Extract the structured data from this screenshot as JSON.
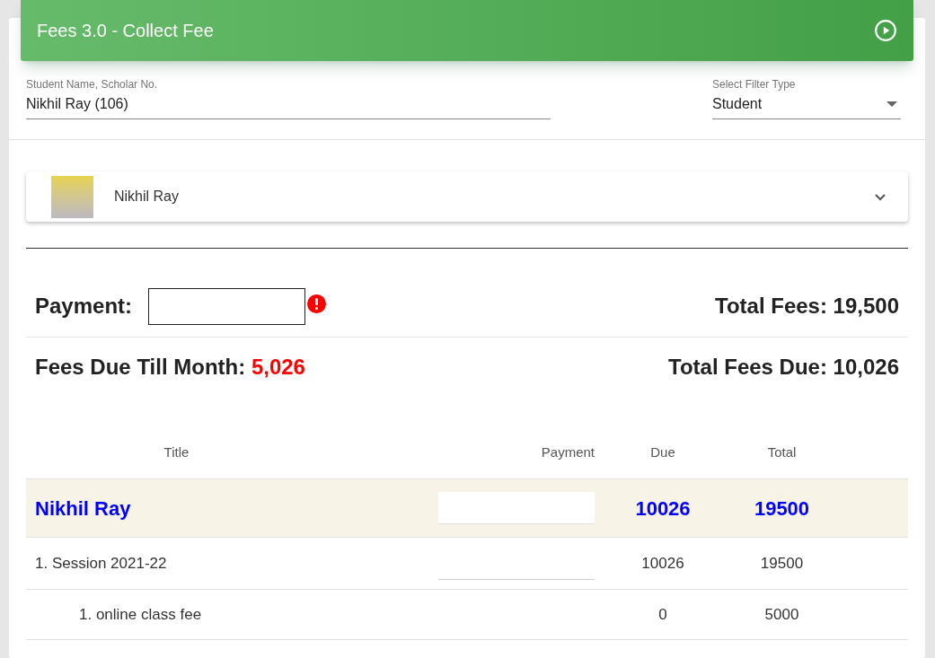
{
  "header": {
    "title": "Fees 3.0 - Collect Fee"
  },
  "student_field": {
    "label": "Student Name, Scholar No.",
    "value": "Nikhil Ray (106)"
  },
  "filter_field": {
    "label": "Select Filter Type",
    "value": "Student"
  },
  "student_panel": {
    "name": "Nikhil Ray",
    "expanded": false
  },
  "payment": {
    "label": "Payment:",
    "error": true
  },
  "total_fees": {
    "label": "Total Fees:",
    "value": "19,500"
  },
  "fees_due_till_month": {
    "label": "Fees Due Till Month:",
    "value": "5,026"
  },
  "total_fees_due": {
    "label": "Total Fees Due:",
    "value": "10,026"
  },
  "table": {
    "columns": [
      "Title",
      "Payment",
      "Due",
      "Total"
    ],
    "rows": [
      {
        "kind": "student",
        "title": "Nikhil Ray",
        "due": "10026",
        "total": "19500",
        "children": [
          {
            "kind": "session",
            "title": "1. Session 2021-22",
            "due": "10026",
            "total": "19500",
            "children": [
              {
                "kind": "fee",
                "title": "1. online class fee",
                "due": "0",
                "total": "5000"
              }
            ]
          }
        ]
      }
    ]
  }
}
